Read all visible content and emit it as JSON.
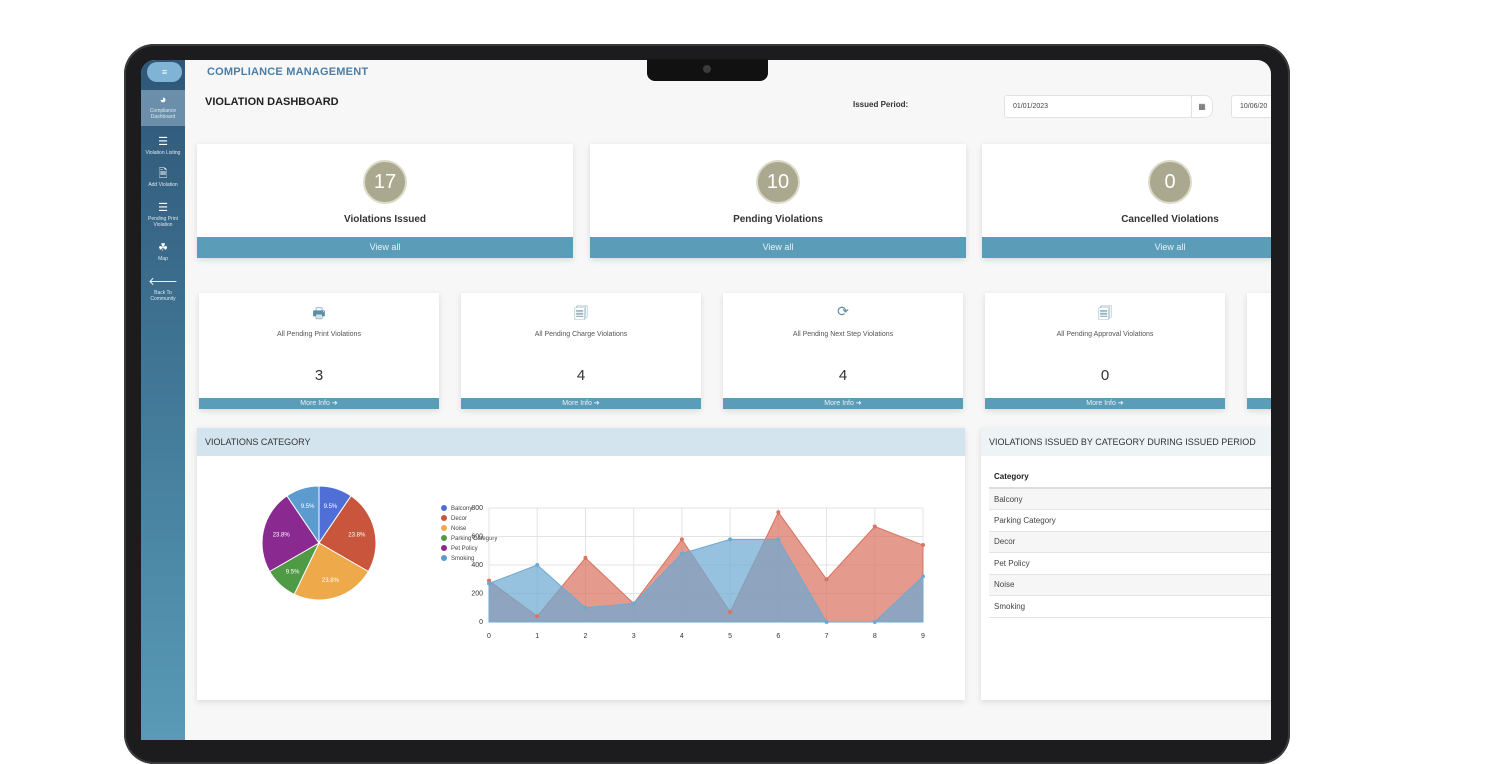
{
  "app": {
    "title": "COMPLIANCE MANAGEMENT",
    "menu_icon": "hamburger-icon"
  },
  "sidebar": {
    "items": [
      {
        "icon": "dashboard-icon",
        "glyph": "◕",
        "label": "Compliance Dashboard",
        "active": true
      },
      {
        "icon": "list-icon",
        "glyph": "☰",
        "label": "Violation Listing"
      },
      {
        "icon": "document-icon",
        "glyph": "🗎",
        "label": "Add Violation"
      },
      {
        "icon": "list-icon",
        "glyph": "☰",
        "label": "Pending Print Violation"
      },
      {
        "icon": "map-icon",
        "glyph": "☘",
        "label": "Map"
      },
      {
        "icon": "arrow-left-icon",
        "glyph": "🡐",
        "label": "Back To Community"
      }
    ]
  },
  "header": {
    "page_title": "VIOLATION DASHBOARD",
    "period_label": "Issued Period:",
    "date_from": "01/01/2023",
    "date_to": "10/06/20",
    "calendar_icon": "calendar-icon"
  },
  "stats": [
    {
      "value": "17",
      "label": "Violations Issued",
      "action": "View all"
    },
    {
      "value": "10",
      "label": "Pending Violations",
      "action": "View all"
    },
    {
      "value": "0",
      "label": "Cancelled Violations",
      "action": "View all"
    }
  ],
  "pending": [
    {
      "icon": "print-icon",
      "glyph": "🖶",
      "label": "All Pending Print Violations",
      "value": "3",
      "action": "More Info ➜"
    },
    {
      "icon": "charge-icon",
      "glyph": "🗐",
      "label": "All Pending Charge Violations",
      "value": "4",
      "action": "More Info ➜"
    },
    {
      "icon": "refresh-icon",
      "glyph": "⟳",
      "label": "All Pending Next Step Violations",
      "value": "4",
      "action": "More Info ➜"
    },
    {
      "icon": "approval-icon",
      "glyph": "🗐",
      "label": "All Pending Approval Violations",
      "value": "0",
      "action": "More Info ➜"
    }
  ],
  "category_panel": {
    "title": "VIOLATIONS CATEGORY"
  },
  "table_panel": {
    "title": "VIOLATIONS ISSUED BY CATEGORY DURING ISSUED PERIOD",
    "header": "Category",
    "rows": [
      "Balcony",
      "Parking Category",
      "Decor",
      "Pet Policy",
      "Noise",
      "Smoking"
    ]
  },
  "chart_data": [
    {
      "type": "pie",
      "categories": [
        "Balcony",
        "Decor",
        "Noise",
        "Parking Category",
        "Pet Policy",
        "Smoking"
      ],
      "values": [
        9.5,
        23.8,
        23.8,
        9.5,
        23.8,
        9.5
      ],
      "labels": [
        "9.5%",
        "23.8%",
        "23.8%",
        "9.5%",
        "23.8%",
        "9.5%"
      ],
      "colors": [
        "#4f6fd6",
        "#c9553c",
        "#eea94a",
        "#4e9a45",
        "#8a2a90",
        "#5b9bd0"
      ],
      "legend": "right"
    },
    {
      "type": "area",
      "x": [
        0,
        1,
        2,
        3,
        4,
        5,
        6,
        7,
        8,
        9
      ],
      "ylim": [
        0,
        800
      ],
      "xlim": [
        0,
        9
      ],
      "yticks": [
        0,
        200,
        400,
        600,
        800
      ],
      "grid": true,
      "series": [
        {
          "values": [
            290,
            40,
            450,
            130,
            580,
            70,
            770,
            300,
            670,
            540
          ],
          "color": "#d9735f"
        },
        {
          "values": [
            270,
            400,
            100,
            130,
            480,
            580,
            580,
            0,
            0,
            320
          ],
          "color": "#6ea9d2"
        }
      ]
    }
  ]
}
